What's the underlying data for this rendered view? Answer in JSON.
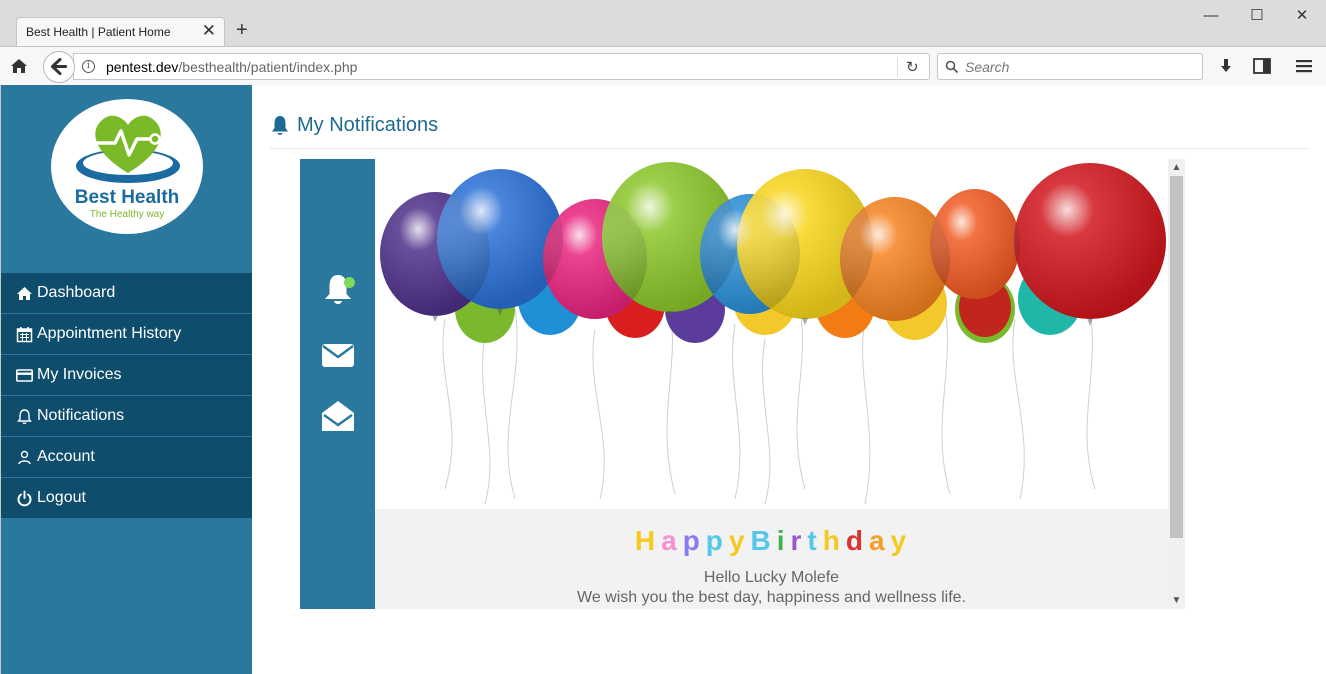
{
  "browser": {
    "tab_title": "Best Health | Patient Home",
    "tab_close": "✕",
    "new_tab": "+",
    "window": {
      "minimize": "—",
      "maximize": "☐",
      "close": "✕"
    },
    "url_host": "pentest.dev",
    "url_path": "/besthealth/patient/index.php",
    "search_placeholder": "Search"
  },
  "logo": {
    "title": "Best Health",
    "tagline": "The Healthy way"
  },
  "sidebar": {
    "items": [
      {
        "label": "Dashboard",
        "icon": "home-icon"
      },
      {
        "label": "Appointment History",
        "icon": "calendar-icon"
      },
      {
        "label": "My Invoices",
        "icon": "credit-card-icon"
      },
      {
        "label": "Notifications",
        "icon": "bell-icon"
      },
      {
        "label": "Account",
        "icon": "user-icon"
      },
      {
        "label": "Logout",
        "icon": "power-icon"
      }
    ]
  },
  "main": {
    "heading": "My Notifications"
  },
  "notification": {
    "greeting_letters": [
      "H",
      "a",
      "p",
      "p",
      "y",
      "B",
      "i",
      "r",
      "t",
      "h",
      "d",
      "a",
      "y"
    ],
    "greeting_colors": [
      "#f7c81e",
      "#f58fd1",
      "#8a7cf0",
      "#54c8e8",
      "#f7c81e",
      "#54c8e8",
      "#3cb44b",
      "#9b59d0",
      "#54c8e8",
      "#f7c81e",
      "#e03030",
      "#f59e2a",
      "#f7c81e"
    ],
    "hello": "Hello Lucky Molefe",
    "message": "We wish you the best day, happiness and wellness life."
  },
  "colors": {
    "sidebar_bg": "#2a789e",
    "menu_bg": "#0e4d6b",
    "heading": "#1e6a93",
    "brand_green": "#7ab928"
  }
}
